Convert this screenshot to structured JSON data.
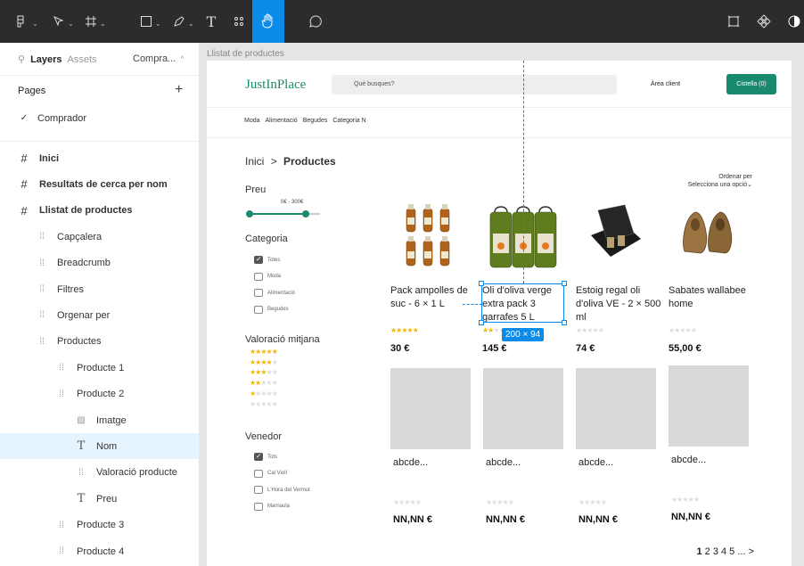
{
  "toolbar": {
    "tools": [
      "main-menu",
      "move",
      "frame",
      "shape",
      "pen",
      "text",
      "resources",
      "hand",
      "comment"
    ],
    "right_tools": [
      "present",
      "components",
      "theme"
    ],
    "accent": "#0c8ce9",
    "text_tool_glyph": "T"
  },
  "left_panel": {
    "tabs": {
      "layers": "Layers",
      "assets": "Assets",
      "page_selector": "Compra..."
    },
    "pages_label": "Pages",
    "add_glyph": "+",
    "current_page": "Comprador",
    "layers": [
      {
        "label": "Inici",
        "type": "frame"
      },
      {
        "label": "Resultats de cerca per nom",
        "type": "frame"
      },
      {
        "label": "Llistat de productes",
        "type": "frame"
      },
      {
        "label": "Capçalera",
        "type": "group"
      },
      {
        "label": "Breadcrumb",
        "type": "group"
      },
      {
        "label": "Filtres",
        "type": "group"
      },
      {
        "label": "Orgenar per",
        "type": "group"
      },
      {
        "label": "Productes",
        "type": "group"
      },
      {
        "label": "Producte 1",
        "type": "group"
      },
      {
        "label": "Producte 2",
        "type": "group"
      },
      {
        "label": "Imatge",
        "type": "image"
      },
      {
        "label": "Nom",
        "type": "text",
        "selected": true
      },
      {
        "label": "Valoració producte",
        "type": "group"
      },
      {
        "label": "Preu",
        "type": "text"
      },
      {
        "label": "Producte 3",
        "type": "group"
      },
      {
        "label": "Producte 4",
        "type": "group"
      }
    ]
  },
  "canvas": {
    "frame_label": "Llistat de productes",
    "selection_size": "200 × 94"
  },
  "site": {
    "logo": "JustInPlace",
    "search_placeholder": "Què busques?",
    "area_client": "Àrea client",
    "cart": "Cistella (0)",
    "menu": [
      "Moda",
      "Alimentació",
      "Begudes",
      "Categoria N"
    ],
    "breadcrumb": {
      "home": "Inici",
      "sep": ">",
      "current": "Productes"
    },
    "filters": {
      "price_title": "Preu",
      "price_range": "0€ - 300€",
      "category_title": "Categoria",
      "categories": [
        {
          "label": "Totes",
          "checked": true
        },
        {
          "label": "Moda",
          "checked": false
        },
        {
          "label": "Alimentació",
          "checked": false
        },
        {
          "label": "Begudes",
          "checked": false
        }
      ],
      "rating_title": "Valoració mitjana",
      "rating_rows": [
        5,
        4,
        3,
        2,
        1,
        0
      ],
      "seller_title": "Venedor",
      "sellers": [
        {
          "label": "Tots",
          "checked": true
        },
        {
          "label": "Cal Violí",
          "checked": false
        },
        {
          "label": "L'Hora del Vermut",
          "checked": false
        },
        {
          "label": "Marnaula",
          "checked": false
        }
      ]
    },
    "sort": {
      "label": "Ordenar per",
      "value": "Selecciona una opció"
    },
    "products": [
      {
        "name": "Pack ampolles de suc - 6 × 1 L",
        "rating": 5,
        "price": "30 €"
      },
      {
        "name": "Oli d'oliva verge extra pack 3 garrafes 5 L",
        "rating": 2,
        "price": "145 €"
      },
      {
        "name": "Estoig regal oli d'oliva VE - 2 × 500 ml",
        "rating": 0,
        "price": "74 €"
      },
      {
        "name": "Sabates wallabee home",
        "rating": 0,
        "price": "55,00 €"
      }
    ],
    "placeholders": [
      {
        "name": "abcde...",
        "price": "NN,NN €"
      },
      {
        "name": "abcde...",
        "price": "NN,NN €"
      },
      {
        "name": "abcde...",
        "price": "NN,NN €"
      },
      {
        "name": "abcde...",
        "price": "NN,NN €"
      }
    ],
    "pagination": {
      "current": "1",
      "others": "2 3 4 5 ... >"
    },
    "colors": {
      "brand": "#1a8a6e",
      "star": "#f2b705"
    }
  }
}
